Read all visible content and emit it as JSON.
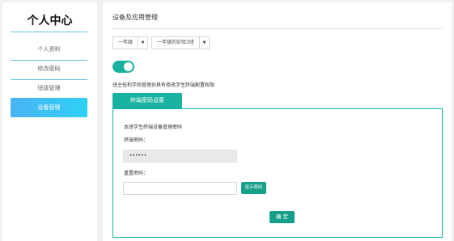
{
  "sidebar": {
    "title": "个人中心",
    "items": [
      {
        "label": "个人资料"
      },
      {
        "label": "修改密码"
      },
      {
        "label": "班级管理"
      },
      {
        "label": "设备管理"
      }
    ]
  },
  "main": {
    "title": "设备及应用管理",
    "grade_select": {
      "value": "一年级"
    },
    "class_select": {
      "value": "一年级的实验3班"
    },
    "toggle": {
      "state": "on"
    },
    "hint": "班主任和学校管理员具有修改学生终端配置权限",
    "tab_label": "终端密码设置",
    "panel": {
      "section_title": "本班学生终端设备管理密码",
      "terminal_password_label": "终端密码：",
      "terminal_password_value": "••••••",
      "reset_password_label": "重置密码：",
      "reset_password_value": "",
      "show_password_button": "显示密码",
      "confirm_button": "确 定"
    }
  },
  "colors": {
    "accent": "#17b3a0",
    "button": "#17a089",
    "sidebar_active_start": "#4ab3f4",
    "sidebar_active_end": "#2fd0f5",
    "sidebar_line": "#59c9e4"
  }
}
